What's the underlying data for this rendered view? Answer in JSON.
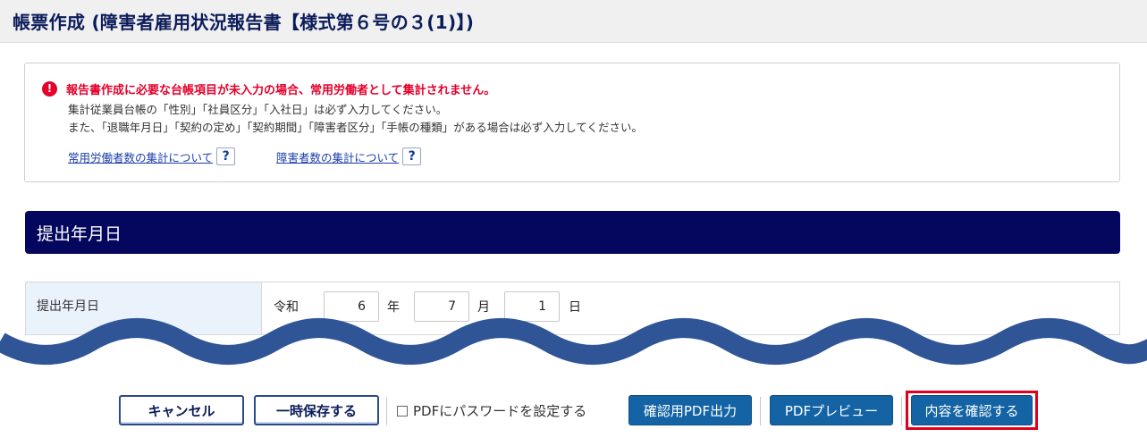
{
  "header": {
    "title": "帳票作成 (障害者雇用状況報告書【様式第６号の３(1)】)"
  },
  "notice": {
    "icon": "exclamation-icon",
    "warning": "報告書作成に必要な台帳項目が未入力の場合、常用労働者として集計されません。",
    "line1": "集計従業員台帳の「性別」「社員区分」「入社日」は必ず入力してください。",
    "line2": "また、「退職年月日」「契約の定め」「契約期間」「障害者区分」「手帳の種類」がある場合は必ず入力してください。",
    "help_links": [
      {
        "label": "常用労働者数の集計について",
        "icon": "?"
      },
      {
        "label": "障害者数の集計について",
        "icon": "?"
      }
    ]
  },
  "section": {
    "title": "提出年月日"
  },
  "submit_date": {
    "label": "提出年月日",
    "era": "令和",
    "year": "6",
    "year_unit": "年",
    "month": "7",
    "month_unit": "月",
    "day": "1",
    "day_unit": "日"
  },
  "footer": {
    "cancel": "キャンセル",
    "save_draft": "一時保存する",
    "pdf_password": "PDFにパスワードを設定する",
    "pdf_password_checked": false,
    "confirm_pdf": "確認用PDF出力",
    "pdf_preview": "PDFプレビュー",
    "confirm_content": "内容を確認する"
  },
  "colors": {
    "header_text": "#0c1c5a",
    "section_bar": "#05075e",
    "warning": "#e4002b",
    "primary_button": "#1464a5",
    "wave": "#2f5597",
    "highlight": "#e0001b"
  }
}
